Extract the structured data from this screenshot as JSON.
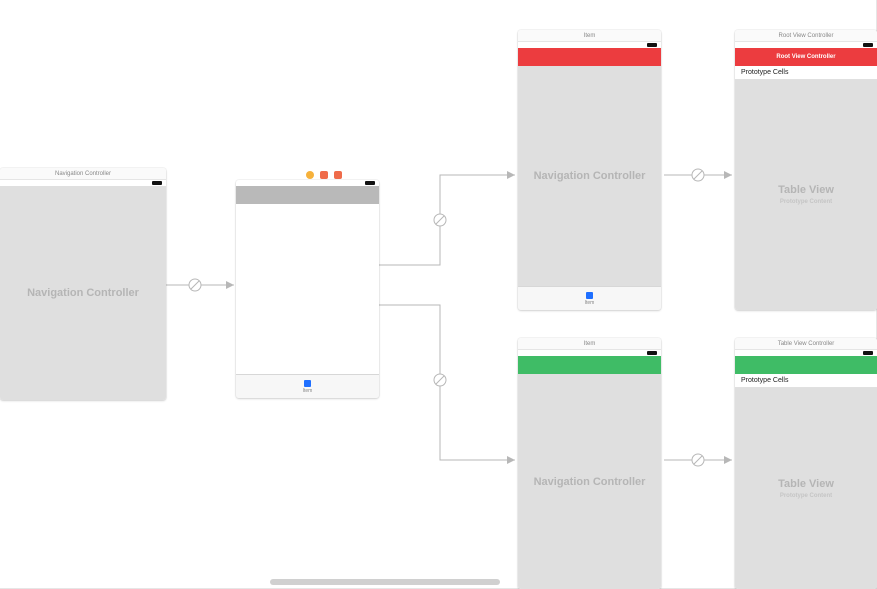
{
  "scenes": {
    "nav1": {
      "header": "Navigation Controller",
      "label": "Navigation Controller"
    },
    "tabbar": {
      "tab_label": "Item"
    },
    "navRed": {
      "header": "Item",
      "label": "Navigation Controller"
    },
    "rootRed": {
      "header": "Root View Controller",
      "nav_title": "Root View Controller",
      "prototype_cells": "Prototype Cells",
      "table_view": "Table View",
      "prototype_content": "Prototype Content"
    },
    "navGreen": {
      "header": "Item",
      "label": "Navigation Controller"
    },
    "rootGreen": {
      "header": "Table View Controller",
      "prototype_cells": "Prototype Cells",
      "table_view": "Table View",
      "prototype_content": "Prototype Content"
    }
  }
}
